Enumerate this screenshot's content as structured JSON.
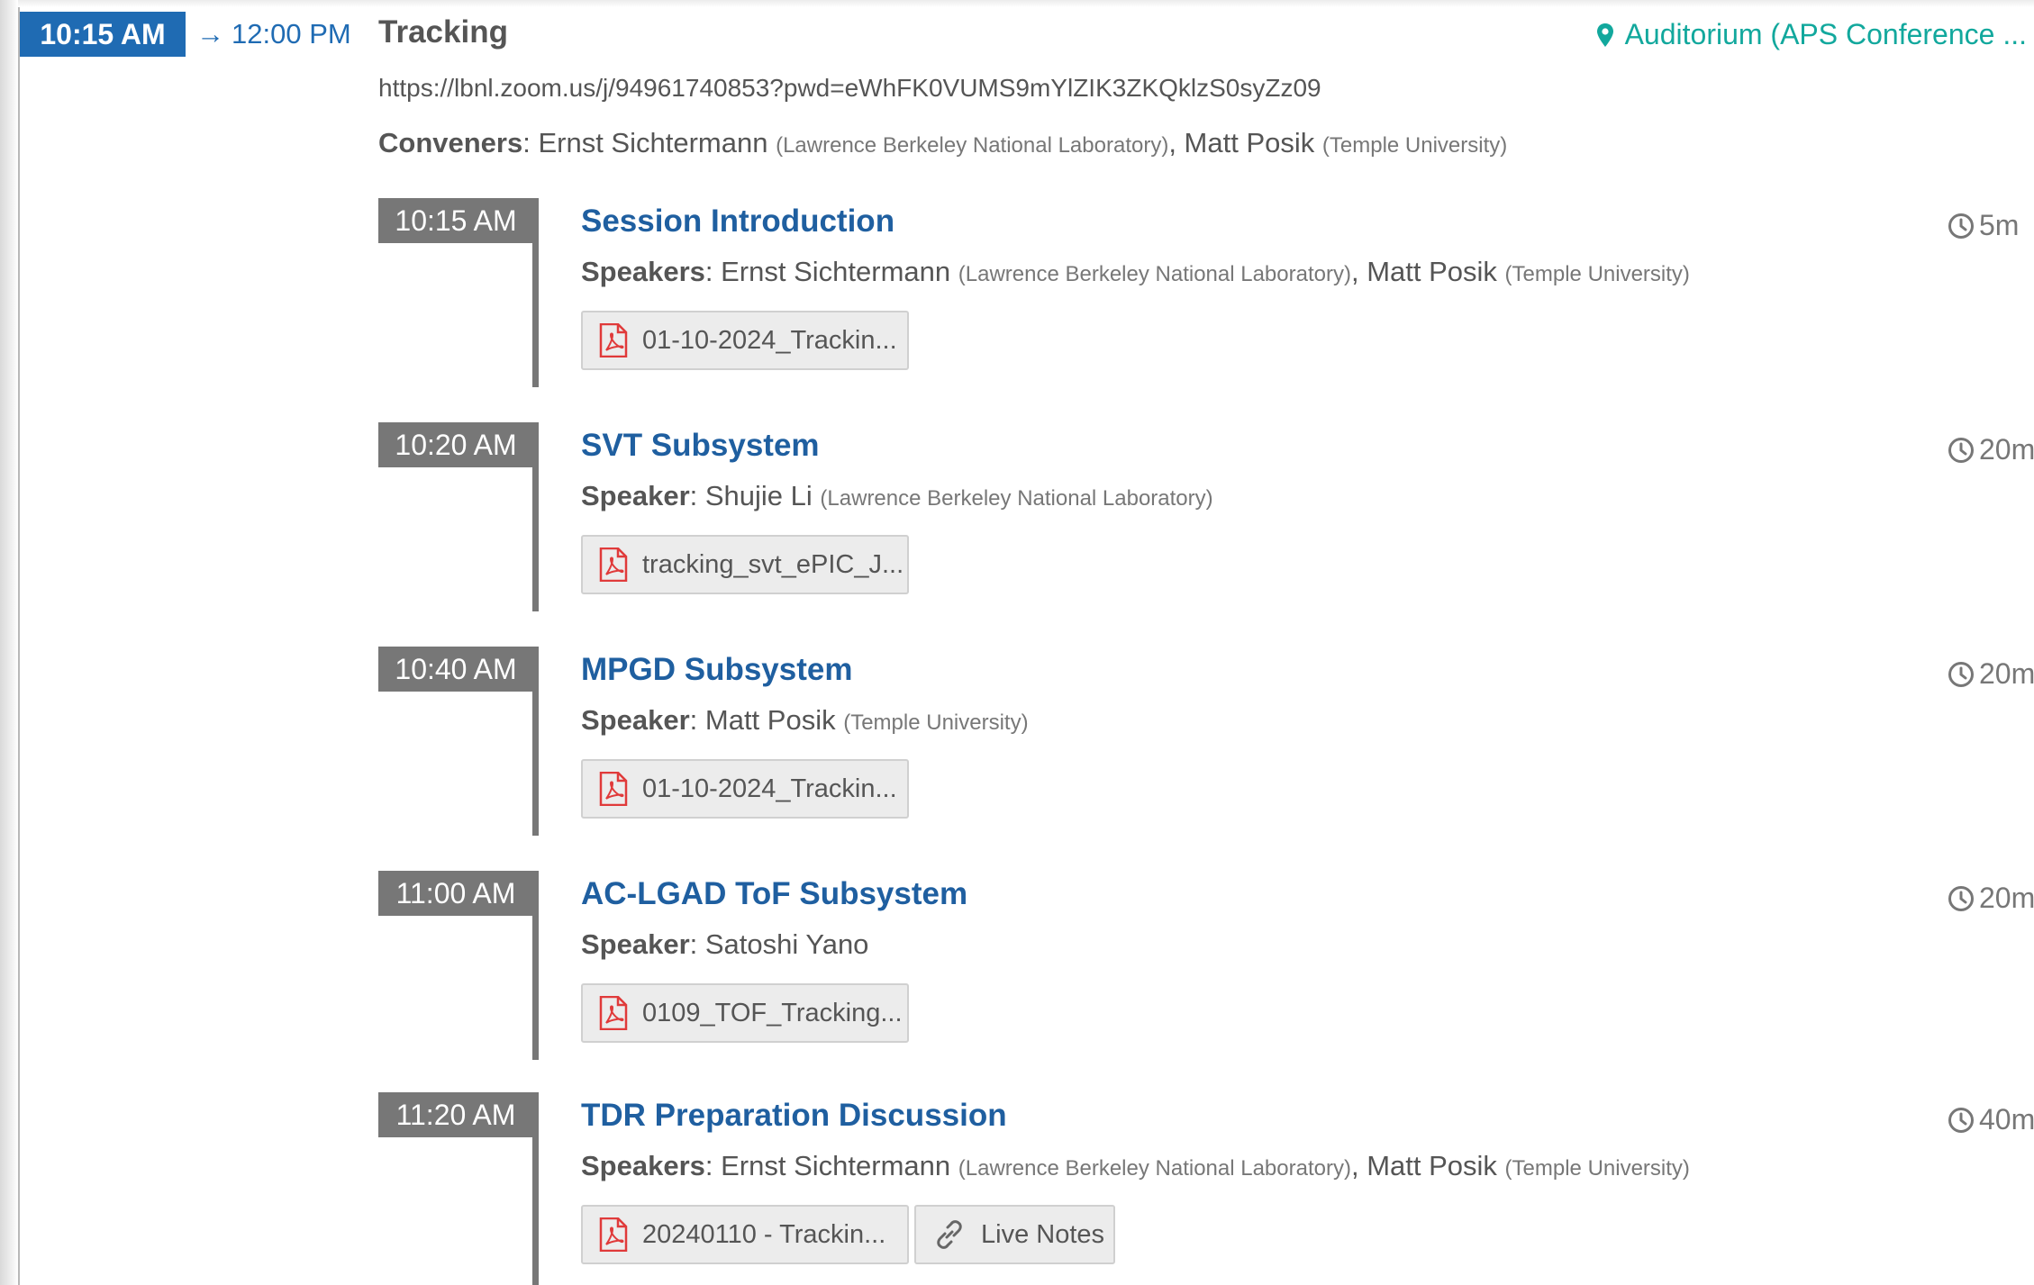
{
  "session": {
    "start": "10:15 AM",
    "end": "12:00 PM",
    "arrow": "→",
    "title": "Tracking",
    "location": "Auditorium (APS Conference ...",
    "zoom_link": "https://lbnl.zoom.us/j/94961740853?pwd=eWhFK0VUMS9mYlZIK3ZKQklzS0syZz09",
    "conveners_label": "Conveners",
    "conveners": [
      {
        "name": "Ernst Sichtermann",
        "affiliation": "(Lawrence Berkeley National Laboratory)"
      },
      {
        "name": "Matt Posik",
        "affiliation": "(Temple University)"
      }
    ]
  },
  "contributions": [
    {
      "time": "10:15 AM",
      "title": "Session Introduction",
      "duration": "5m",
      "speaker_label": "Speakers",
      "speakers": [
        {
          "name": "Ernst Sichtermann",
          "affiliation": "(Lawrence Berkeley National Laboratory)"
        },
        {
          "name": "Matt Posik",
          "affiliation": "(Temple University)"
        }
      ],
      "attachments": [
        {
          "icon": "pdf-icon",
          "label": "01-10-2024_Trackin..."
        }
      ]
    },
    {
      "time": "10:20 AM",
      "title": "SVT Subsystem",
      "duration": "20m",
      "speaker_label": "Speaker",
      "speakers": [
        {
          "name": "Shujie Li",
          "affiliation": "(Lawrence Berkeley National Laboratory)"
        }
      ],
      "attachments": [
        {
          "icon": "pdf-icon",
          "label": "tracking_svt_ePIC_J..."
        }
      ]
    },
    {
      "time": "10:40 AM",
      "title": "MPGD Subsystem",
      "duration": "20m",
      "speaker_label": "Speaker",
      "speakers": [
        {
          "name": "Matt Posik",
          "affiliation": "(Temple University)"
        }
      ],
      "attachments": [
        {
          "icon": "pdf-icon",
          "label": "01-10-2024_Trackin..."
        }
      ]
    },
    {
      "time": "11:00 AM",
      "title": "AC-LGAD ToF Subsystem",
      "duration": "20m",
      "speaker_label": "Speaker",
      "speakers": [
        {
          "name": "Satoshi Yano",
          "affiliation": ""
        }
      ],
      "attachments": [
        {
          "icon": "pdf-icon",
          "label": "0109_TOF_Tracking..."
        }
      ]
    },
    {
      "time": "11:20 AM",
      "title": "TDR Preparation Discussion",
      "duration": "40m",
      "speaker_label": "Speakers",
      "speakers": [
        {
          "name": "Ernst Sichtermann",
          "affiliation": "(Lawrence Berkeley National Laboratory)"
        },
        {
          "name": "Matt Posik",
          "affiliation": "(Temple University)"
        }
      ],
      "attachments": [
        {
          "icon": "pdf-icon",
          "label": "20240110 - Trackin..."
        },
        {
          "icon": "link-icon",
          "label": "Live Notes"
        }
      ]
    }
  ],
  "colors": {
    "primary": "#1f6bb3",
    "title_link": "#1f5fa0",
    "location": "#12a89d",
    "time_box": "#777777",
    "pdf_icon": "#e03a3a"
  }
}
